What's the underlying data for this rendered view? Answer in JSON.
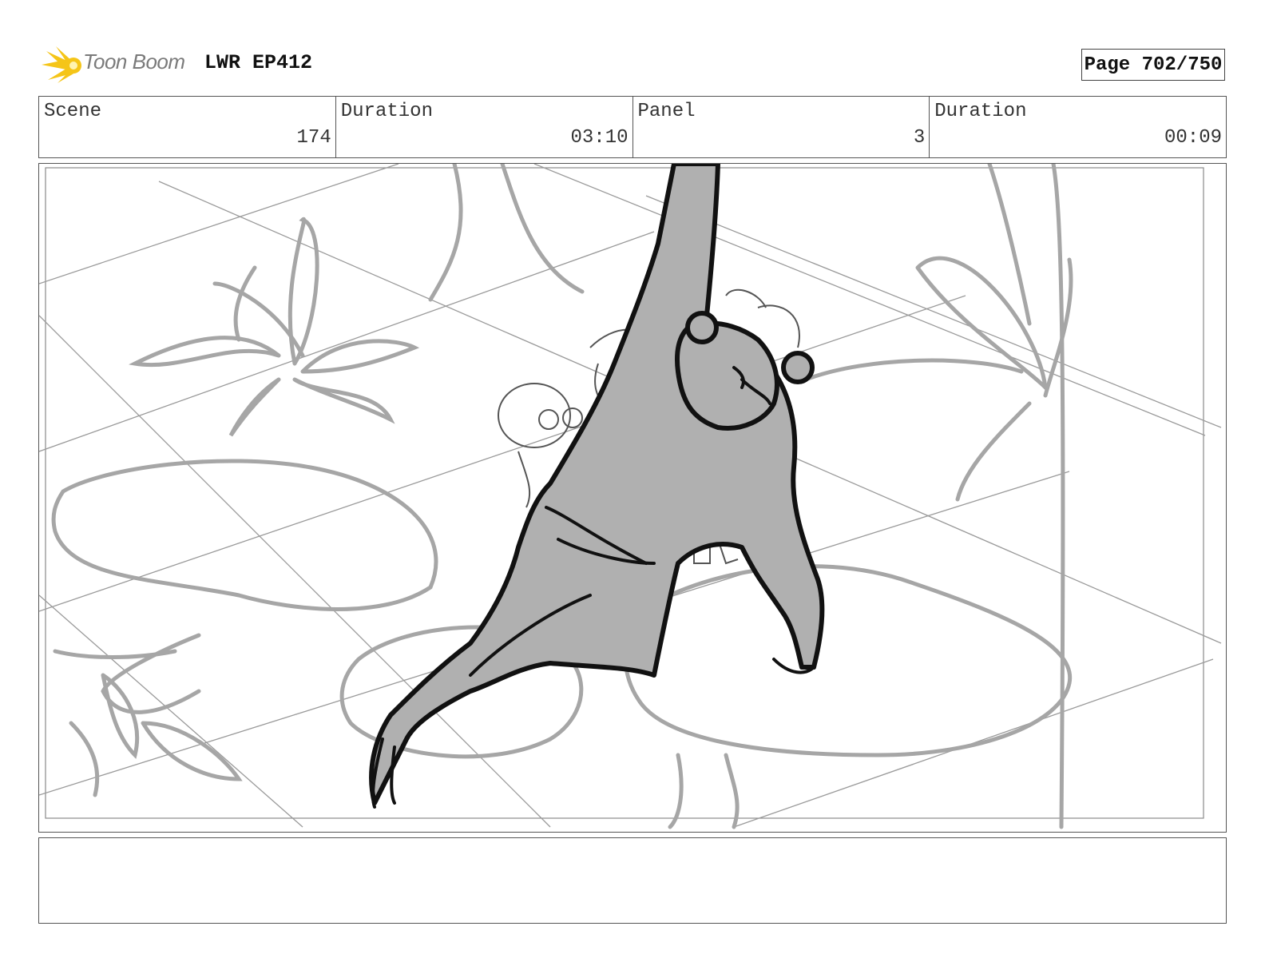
{
  "header": {
    "logo_text": "Toon Boom",
    "project": "LWR EP412",
    "page": "Page 702/750"
  },
  "info": {
    "scene_label": "Scene",
    "scene_value": "174",
    "scene_duration_label": "Duration",
    "scene_duration_value": "03:10",
    "panel_label": "Panel",
    "panel_value": "3",
    "panel_duration_label": "Duration",
    "panel_duration_value": "00:09"
  },
  "notes": {
    "text": ""
  },
  "colors": {
    "logo_accent": "#f5c518",
    "sketch_gray": "#a6a6a6",
    "fill_gray": "#b0b0b0",
    "ink": "#111111"
  }
}
